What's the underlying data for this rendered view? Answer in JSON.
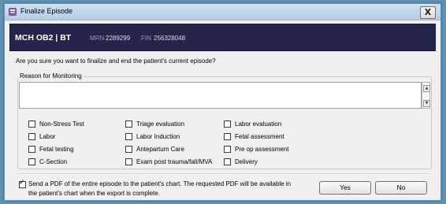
{
  "window": {
    "title": "Finalize Episode",
    "close_label": "X"
  },
  "banner": {
    "patient": "MCH OB2 | BT",
    "mrn_label": "MRN",
    "mrn": "2289299",
    "fin_label": "FIN",
    "fin": "256328048"
  },
  "question": "Are you sure you want to finalize and end the patient's current episode?",
  "reason": {
    "label": "Reason for Monitoring",
    "text": "",
    "columns": [
      [
        "Non-Stress Test",
        "Labor",
        "Fetal testing",
        "C-Section"
      ],
      [
        "Triage evaluation",
        "Labor Induction",
        "Antepartum Care",
        "Exam post trauma/fall/MVA"
      ],
      [
        "Labor evaluation",
        "Fetal assessment",
        "Pre op assessment",
        "Delivery"
      ]
    ]
  },
  "pdf": {
    "checked": true,
    "line1": "Send a PDF of the entire episode to the patient's chart. The requested PDF will be available in",
    "line2": "the patient's chart when the export is complete."
  },
  "buttons": {
    "yes": "Yes",
    "no": "No"
  }
}
